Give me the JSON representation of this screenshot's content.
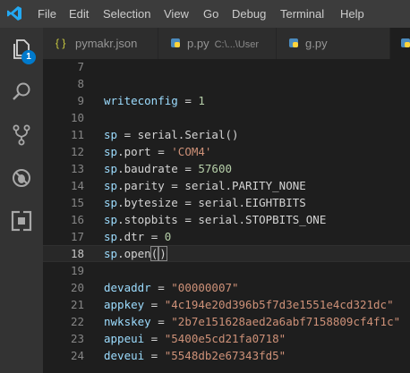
{
  "menubar": {
    "items": [
      "File",
      "Edit",
      "Selection",
      "View",
      "Go",
      "Debug",
      "Terminal",
      "Help"
    ]
  },
  "activity_bar": {
    "explorer_badge": "1",
    "icons": [
      "explorer-icon",
      "search-icon",
      "source-control-icon",
      "debug-icon",
      "extensions-icon"
    ]
  },
  "tabs": [
    {
      "icon_text": "{ }",
      "label": "pymakr.json",
      "path": "",
      "active": false
    },
    {
      "icon_text": "",
      "label": "p.py",
      "path": "C:\\...\\User",
      "active": false
    },
    {
      "icon_text": "",
      "label": "g.py",
      "path": "",
      "active": false
    }
  ],
  "editor": {
    "lines": [
      {
        "n": "7",
        "t": []
      },
      {
        "n": "8",
        "t": []
      },
      {
        "n": "9",
        "t": [
          [
            "var",
            "writeconfig"
          ],
          [
            "op",
            " = "
          ],
          [
            "num",
            "1"
          ]
        ]
      },
      {
        "n": "10",
        "t": []
      },
      {
        "n": "11",
        "t": [
          [
            "var",
            "sp"
          ],
          [
            "op",
            " = serial.Serial()"
          ]
        ]
      },
      {
        "n": "12",
        "t": [
          [
            "var",
            "sp"
          ],
          [
            "op",
            ".port = "
          ],
          [
            "str",
            "'COM4'"
          ]
        ]
      },
      {
        "n": "13",
        "t": [
          [
            "var",
            "sp"
          ],
          [
            "op",
            ".baudrate = "
          ],
          [
            "num",
            "57600"
          ]
        ]
      },
      {
        "n": "14",
        "t": [
          [
            "var",
            "sp"
          ],
          [
            "op",
            ".parity = serial.PARITY_NONE"
          ]
        ]
      },
      {
        "n": "15",
        "t": [
          [
            "var",
            "sp"
          ],
          [
            "op",
            ".bytesize = serial.EIGHTBITS"
          ]
        ]
      },
      {
        "n": "16",
        "t": [
          [
            "var",
            "sp"
          ],
          [
            "op",
            ".stopbits = serial.STOPBITS_ONE"
          ]
        ]
      },
      {
        "n": "17",
        "t": [
          [
            "var",
            "sp"
          ],
          [
            "op",
            ".dtr = "
          ],
          [
            "num",
            "0"
          ]
        ]
      },
      {
        "n": "18",
        "t": [
          [
            "var",
            "sp"
          ],
          [
            "op",
            ".open"
          ],
          [
            "brk",
            "("
          ],
          [
            "cur",
            ""
          ],
          [
            "brk",
            ")"
          ]
        ],
        "current": true
      },
      {
        "n": "19",
        "t": []
      },
      {
        "n": "20",
        "t": [
          [
            "var",
            "devaddr"
          ],
          [
            "op",
            " = "
          ],
          [
            "str",
            "\"00000007\""
          ]
        ]
      },
      {
        "n": "21",
        "t": [
          [
            "var",
            "appkey"
          ],
          [
            "op",
            " = "
          ],
          [
            "str",
            "\"4c194e20d396b5f7d3e1551e4cd321dc\""
          ]
        ]
      },
      {
        "n": "22",
        "t": [
          [
            "var",
            "nwkskey"
          ],
          [
            "op",
            " = "
          ],
          [
            "str",
            "\"2b7e151628aed2a6abf7158809cf4f1c\""
          ]
        ]
      },
      {
        "n": "23",
        "t": [
          [
            "var",
            "appeui"
          ],
          [
            "op",
            " = "
          ],
          [
            "str",
            "\"5400e5cd21fa0718\""
          ]
        ]
      },
      {
        "n": "24",
        "t": [
          [
            "var",
            "deveui"
          ],
          [
            "op",
            " = "
          ],
          [
            "str",
            "\"5548db2e67343fd5\""
          ]
        ]
      }
    ]
  },
  "colors": {
    "menubar_bg": "#3c3c3c",
    "activity_bg": "#333333",
    "editor_bg": "#1e1e1e",
    "accent": "#007acc",
    "variable": "#9cdcfe",
    "number": "#b5cea8",
    "string": "#ce9178"
  }
}
